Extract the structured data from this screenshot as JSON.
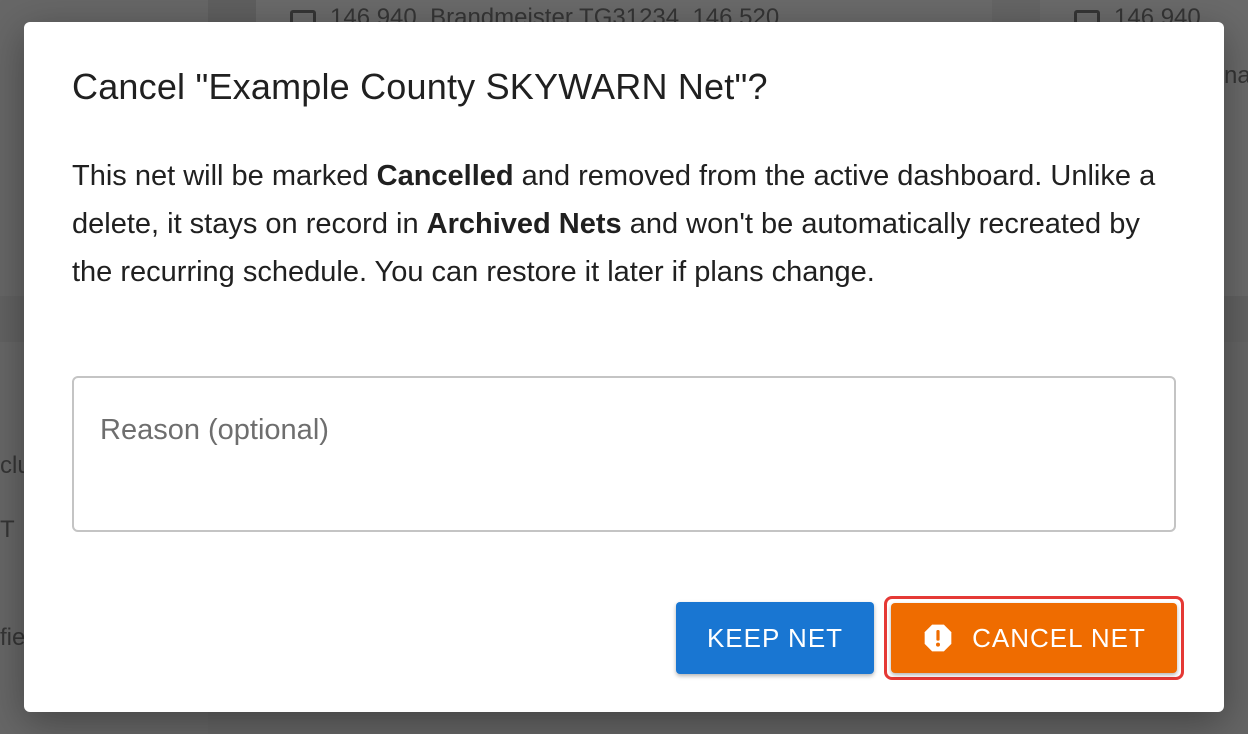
{
  "background": {
    "card1_text": "146.940, Brandmeister TG31234, 146.520",
    "card2_text": "146.940, ",
    "side_fragments": [
      "clu",
      "T",
      "fie"
    ],
    "right_fragment": "na"
  },
  "dialog": {
    "title": "Cancel \"Example County SKYWARN Net\"?",
    "body": {
      "part1": "This net will be marked ",
      "bold1": "Cancelled",
      "part2": " and removed from the active dashboard. Unlike a delete, it stays on record in ",
      "bold2": "Archived Nets",
      "part3": " and won't be automatically recreated by the recurring schedule. You can restore it later if plans change."
    },
    "reason": {
      "placeholder": "Reason (optional)",
      "value": ""
    },
    "keep_label": "KEEP NET",
    "cancel_label": "CANCEL NET"
  },
  "colors": {
    "keep_button": "#1976d2",
    "cancel_button": "#ef6c00",
    "focus_ring": "#e53935"
  },
  "icons": {
    "cancel_button_icon": "warning-octagon-icon",
    "card_icon": "radio-icon"
  }
}
